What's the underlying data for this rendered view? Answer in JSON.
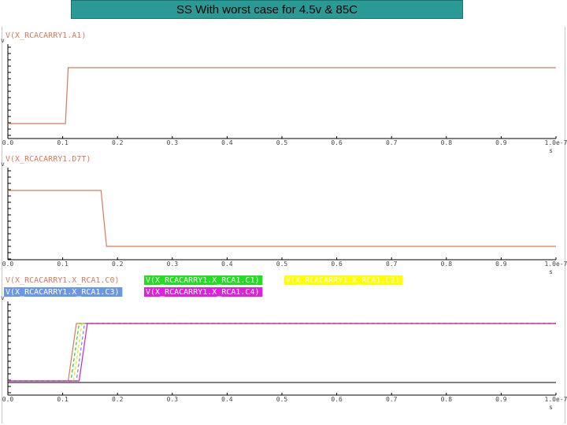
{
  "title": "SS With worst case for 4.5v & 85C",
  "x_ticks": [
    "0.0",
    "0.1",
    "0.2",
    "0.3",
    "0.4",
    "0.5",
    "0.6",
    "0.7",
    "0.8",
    "0.9",
    "1.0e-7"
  ],
  "x_unit": "s",
  "y_unit": "v",
  "colors": {
    "banner": "#2a9a96",
    "trace": "#d9785c",
    "axis": "#000000"
  },
  "chart_data": [
    {
      "type": "line",
      "series": [
        {
          "name": "V(X_RCACARRY1.A1)",
          "color": "#d9785c",
          "x": [
            0.0,
            0.105,
            0.11,
            1.0
          ],
          "y": [
            0,
            0,
            1,
            1
          ]
        }
      ]
    },
    {
      "type": "line",
      "series": [
        {
          "name": "V(X_RCACARRY1.D7T)",
          "color": "#d9785c",
          "x": [
            0.0,
            0.17,
            0.18,
            1.0
          ],
          "y": [
            1,
            1,
            0,
            0
          ]
        }
      ]
    },
    {
      "type": "line",
      "series": [
        {
          "name": "V(X_RCACARRY1.X_RCA1.C0)",
          "color": "#d9785c",
          "label_bg": "#ffffff",
          "x": [
            0.0,
            0.11,
            0.125,
            1.0
          ],
          "y": [
            0,
            0,
            1,
            1
          ]
        },
        {
          "name": "V(X_RCACARRY1.X_RCA1.C1)",
          "color": "#22cc22",
          "label_bg": "#22dd22",
          "x": [
            0.0,
            0.115,
            0.13,
            1.0
          ],
          "y": [
            0,
            0,
            1,
            1
          ]
        },
        {
          "name": "V(X_RCACARRY1.X_RCA1.C2)",
          "color": "#e6e600",
          "label_bg": "#ffff00",
          "x": [
            0.0,
            0.12,
            0.135,
            1.0
          ],
          "y": [
            0,
            0,
            1,
            1
          ]
        },
        {
          "name": "V(X_RCACARRY1.X_RCA1.C3)",
          "color": "#5b8de0",
          "label_bg": "#6a96e6",
          "x": [
            0.0,
            0.125,
            0.14,
            1.0
          ],
          "y": [
            0,
            0,
            1,
            1
          ]
        },
        {
          "name": "V(X_RCACARRY1.X_RCA1.C4)",
          "color": "#cc22cc",
          "label_bg": "#dd22dd",
          "x": [
            0.0,
            0.13,
            0.145,
            1.0
          ],
          "y": [
            0,
            0,
            1,
            1
          ]
        }
      ]
    }
  ]
}
